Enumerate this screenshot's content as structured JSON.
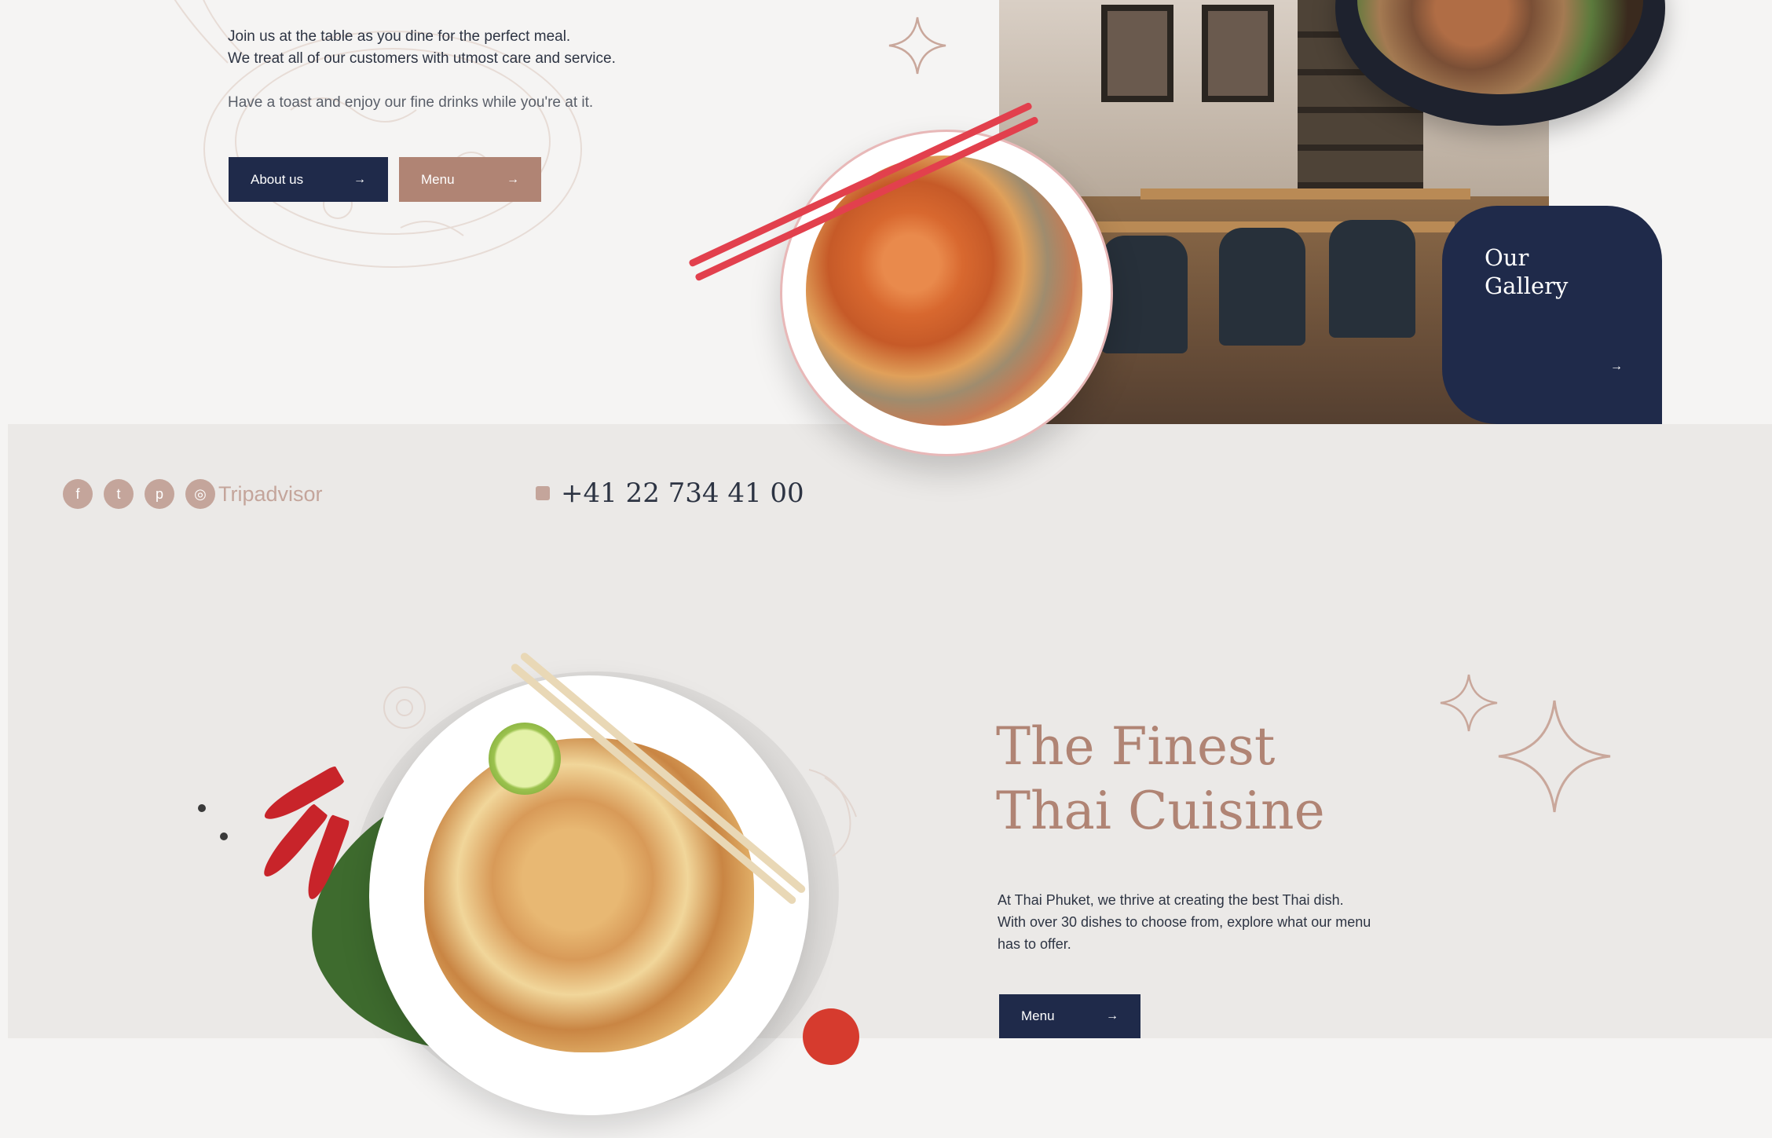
{
  "colors": {
    "navy": "#1f2a4a",
    "terracotta": "#b08474",
    "muted_pink": "#c4a59b",
    "background": "#f5f4f3",
    "band": "#ebe9e7"
  },
  "hero": {
    "intro_line_1": "Join us at the table as you dine for the perfect meal.",
    "intro_line_2": "We treat all of our customers with utmost care and service.",
    "intro_line_3": "Have a toast and enjoy our fine drinks while you're at it.",
    "about_button": "About us",
    "menu_button": "Menu",
    "arrow": "→"
  },
  "gallery": {
    "title_line_1": "Our",
    "title_line_2": "Gallery",
    "arrow": "→"
  },
  "contact": {
    "socials": [
      {
        "icon": "facebook-icon",
        "glyph": "f"
      },
      {
        "icon": "twitter-icon",
        "glyph": "t"
      },
      {
        "icon": "pinterest-icon",
        "glyph": "p"
      }
    ],
    "tripadvisor_label": "Tripadvisor",
    "phone": "+41 22 734 41 00"
  },
  "finest": {
    "title_line_1": "The Finest",
    "title_line_2": "Thai Cuisine",
    "body_line_1": "At Thai Phuket, we thrive at creating the best Thai dish.",
    "body_line_2": "With over 30 dishes to choose from, explore what our menu",
    "body_line_3": "has to offer.",
    "menu_button": "Menu",
    "arrow": "→"
  }
}
